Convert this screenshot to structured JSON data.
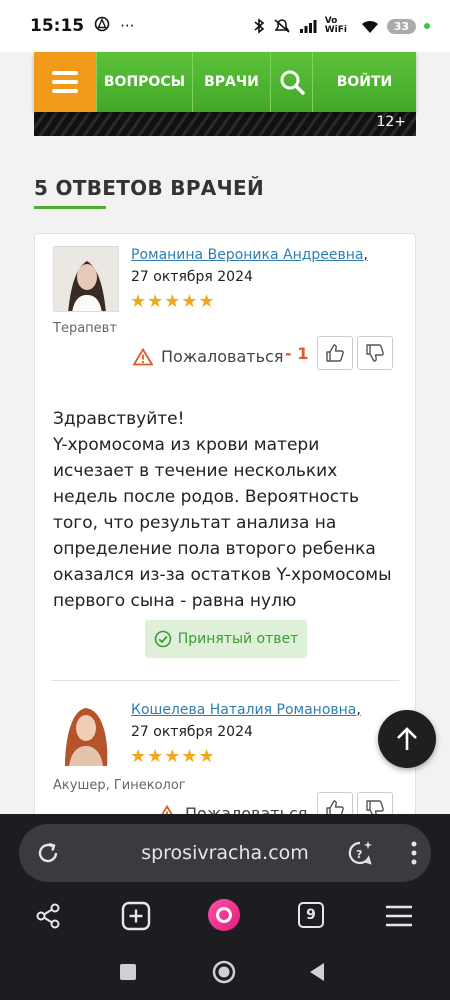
{
  "status_bar": {
    "time": "15:15",
    "dots": "···",
    "network": "Vo WiFi",
    "battery": "33"
  },
  "nav": {
    "items": [
      "ВОПРОСЫ",
      "ВРАЧИ",
      "ВОЙТИ"
    ],
    "age_rating": "12+"
  },
  "section": {
    "heading": "5 ОТВЕТОВ ВРАЧЕЙ"
  },
  "answers": [
    {
      "name": "Романина Вероника Андреевна",
      "date": "27 октября 2024",
      "rating": "★★★★★",
      "specialty": "Терапевт",
      "report_label": "Пожаловаться",
      "score": "- 1",
      "text_lines": [
        "Здравствуйте!",
        "Y-хромосома из крови матери исчезает в течение нескольких недель после родов. Вероятность того, что результат анализа на определение пола второго ребенка оказался из-за остатков Y-хромосомы первого сына - равна нулю"
      ],
      "accepted_label": "Принятый ответ"
    },
    {
      "name": "Кошелева Наталия Романовна",
      "date": "27 октября 2024",
      "rating": "★★★★★",
      "specialty": "Акушер, Гинеколог",
      "report_label": "Пожаловаться"
    }
  ],
  "browser": {
    "url": "sprosivracha.com",
    "tab_count": "9"
  },
  "colors": {
    "nav_green": "#4caf2e",
    "menu_orange": "#f39a1b",
    "link_blue": "#2f7eb3",
    "star_gold": "#f2a81b",
    "score_red": "#e05a2b",
    "accepted_bg": "#dff0d8"
  }
}
